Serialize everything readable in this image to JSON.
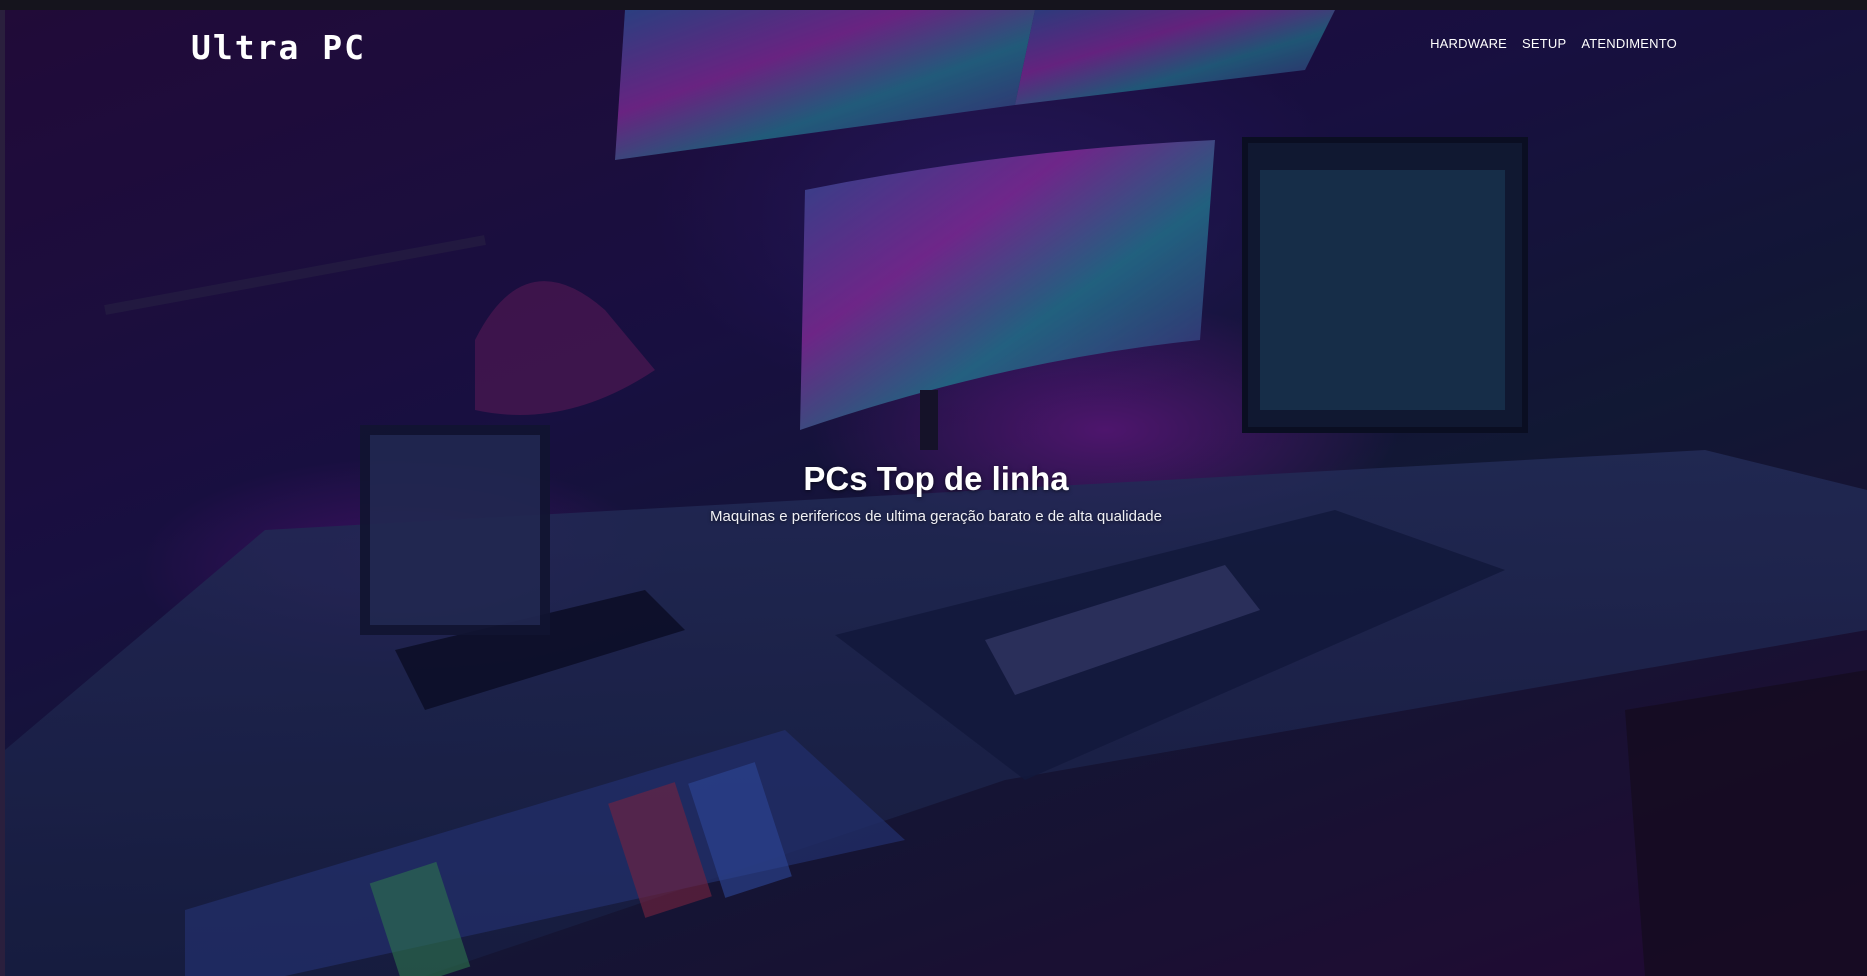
{
  "header": {
    "brand": "Ultra PC",
    "nav": {
      "items": [
        "HARDWARE",
        "SETUP",
        "ATENDIMENTO"
      ]
    }
  },
  "hero": {
    "title": "PCs Top de linha",
    "subtitle": "Maquinas e perifericos de ultima geração barato e de alta qualidade",
    "background_image": "gaming-desk-setup-photo",
    "colors": {
      "accent_purple": "#a21ecb",
      "deep_blue": "#1e1450"
    }
  }
}
